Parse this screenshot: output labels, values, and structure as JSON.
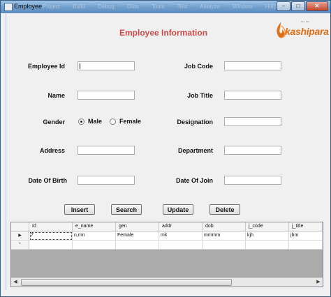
{
  "window": {
    "title": "Employee",
    "bg_menu": [
      "Project",
      "Build",
      "Debug",
      "Data",
      "Tools",
      "Test",
      "Analyze",
      "Window",
      "Help"
    ]
  },
  "controls": {
    "minimize": "–",
    "maximize": "□",
    "close": "✕"
  },
  "heading": "Employee Information",
  "logo": {
    "word": "kashipara",
    "tagline": "••• •••"
  },
  "form": {
    "employee_id_label": "Employee Id",
    "employee_id_value": "",
    "name_label": "Name",
    "name_value": "",
    "gender_label": "Gender",
    "gender_options": [
      "Male",
      "Female"
    ],
    "gender_selected": "Male",
    "address_label": "Address",
    "address_value": "",
    "dob_label": "Date Of Birth",
    "dob_value": "",
    "job_code_label": "Job Code",
    "job_code_value": "",
    "job_title_label": "Job Title",
    "job_title_value": "",
    "designation_label": "Designation",
    "designation_value": "",
    "department_label": "Department",
    "department_value": "",
    "doj_label": "Date Of Join",
    "doj_value": ""
  },
  "buttons": {
    "insert": "Insert",
    "search": "Search",
    "update": "Update",
    "delete": "Delete"
  },
  "grid": {
    "columns": [
      "Id",
      "e_name",
      "gen",
      "addr",
      "dob",
      "j_code",
      "j_title"
    ],
    "rows": [
      {
        "indicator": "▶",
        "cells": [
          "7",
          "n,mn",
          "Female",
          "mk",
          "mmmm",
          "kjh",
          "jbm"
        ]
      },
      {
        "indicator": "*",
        "cells": [
          "",
          "",
          "",
          "",
          "",
          "",
          ""
        ]
      }
    ],
    "scroll_left": "◀",
    "scroll_right": "▶"
  }
}
